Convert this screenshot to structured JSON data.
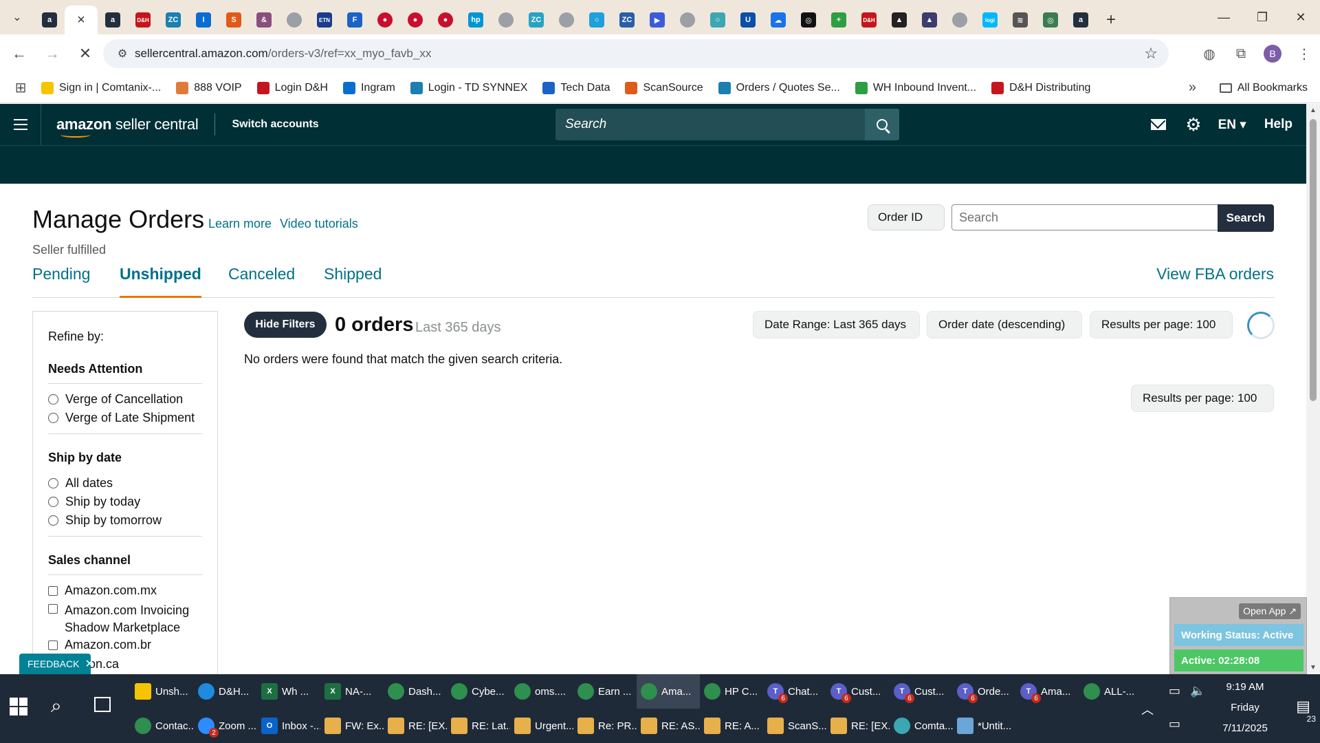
{
  "browser": {
    "tabs": [
      {
        "label": "a",
        "color": "#232f3e"
      },
      {
        "label": "×",
        "color": "",
        "active": true
      },
      {
        "label": "a",
        "color": "#232f3e"
      },
      {
        "label": "D&H",
        "color": "#c4161c"
      },
      {
        "label": "ZC",
        "color": "#1b7fb0"
      },
      {
        "label": "I",
        "color": "#0a6ed1"
      },
      {
        "label": "S",
        "color": "#e05a1a"
      },
      {
        "label": "&",
        "color": "#8a4f7d"
      },
      {
        "label": "",
        "color": "#9aa0a6"
      },
      {
        "label": "ETN",
        "color": "#1a3c8c"
      },
      {
        "label": "F",
        "color": "#1b63c6"
      },
      {
        "label": "●",
        "color": "#c8102e"
      },
      {
        "label": "●",
        "color": "#c8102e"
      },
      {
        "label": "●",
        "color": "#c8102e"
      },
      {
        "label": "hp",
        "color": "#0096d6"
      },
      {
        "label": "",
        "color": "#9aa0a6"
      },
      {
        "label": "ZC",
        "color": "#27a3c4"
      },
      {
        "label": "",
        "color": "#9aa0a6"
      },
      {
        "label": "○",
        "color": "#1ea0dc"
      },
      {
        "label": "ZC",
        "color": "#2a5fa8"
      },
      {
        "label": "▶",
        "color": "#3b5bdb"
      },
      {
        "label": "",
        "color": "#9aa0a6"
      },
      {
        "label": "○",
        "color": "#3ba7b3"
      },
      {
        "label": "U",
        "color": "#0b4fa8"
      },
      {
        "label": "☁",
        "color": "#1a73e8"
      },
      {
        "label": "◎",
        "color": "#111111"
      },
      {
        "label": "+",
        "color": "#2e9e44"
      },
      {
        "label": "D&H",
        "color": "#c4161c"
      },
      {
        "label": "▲",
        "color": "#222222"
      },
      {
        "label": "▲",
        "color": "#3c3c6e"
      },
      {
        "label": "",
        "color": "#9aa0a6"
      },
      {
        "label": "logi",
        "color": "#00b8fc"
      },
      {
        "label": "≋",
        "color": "#555555"
      },
      {
        "label": "◎",
        "color": "#3b7d4f"
      },
      {
        "label": "a",
        "color": "#232f3e"
      }
    ],
    "url_host": "sellercentral.amazon.com",
    "url_path": "/orders-v3/ref=xx_myo_favb_xx",
    "profile_initial": "B",
    "bookmarks": [
      {
        "label": "Sign in | Comtanix-...",
        "color": "#f5c400"
      },
      {
        "label": "888 VOIP",
        "color": "#e07a3a"
      },
      {
        "label": "Login D&H",
        "color": "#c4161c"
      },
      {
        "label": "Ingram",
        "color": "#0a6ed1"
      },
      {
        "label": "Login - TD SYNNEX",
        "color": "#1b7fb0"
      },
      {
        "label": "Tech Data",
        "color": "#1b63c6"
      },
      {
        "label": "ScanSource",
        "color": "#e05a1a"
      },
      {
        "label": "Orders / Quotes Se...",
        "color": "#1b7fb0"
      },
      {
        "label": "WH Inbound Invent...",
        "color": "#2e9e44"
      },
      {
        "label": "D&H Distributing",
        "color": "#c4161c"
      }
    ],
    "all_bookmarks": "All Bookmarks"
  },
  "header": {
    "logo_brand": "amazon",
    "logo_product": "seller central",
    "switch_accounts": "Switch accounts",
    "search_placeholder": "Search",
    "language": "EN",
    "help": "Help"
  },
  "page": {
    "title": "Manage Orders",
    "learn_more": "Learn more",
    "video_tutorials": "Video tutorials",
    "subtitle": "Seller fulfilled",
    "search_type": "Order ID",
    "search_placeholder": "Search",
    "search_button": "Search",
    "tabs": [
      "Pending",
      "Unshipped",
      "Canceled",
      "Shipped"
    ],
    "active_tab": "Unshipped",
    "fba_link": "View FBA orders"
  },
  "filters": {
    "refine_by": "Refine by:",
    "needs_attention": {
      "title": "Needs Attention",
      "options": [
        "Verge of Cancellation",
        "Verge of Late Shipment"
      ]
    },
    "ship_by_date": {
      "title": "Ship by date",
      "options": [
        "All dates",
        "Ship by today",
        "Ship by tomorrow"
      ]
    },
    "sales_channel": {
      "title": "Sales channel",
      "options": [
        "Amazon.com.mx",
        "Amazon.com Invoicing Shadow Marketplace",
        "Amazon.com.br"
      ]
    },
    "partial_option": "zon.ca"
  },
  "results": {
    "hide_filters": "Hide Filters",
    "count": "0 orders",
    "range_label": "Last 365 days",
    "date_range": "Date Range: Last 365 days",
    "sort": "Order date (descending)",
    "per_page": "Results per page: 100",
    "per_page_bottom": "Results per page: 100",
    "empty_message": "No orders were found that match the given search criteria."
  },
  "feedback": {
    "label": "FEEDBACK"
  },
  "widget": {
    "open_app": "Open App ↗",
    "working_status": "Working Status: Active",
    "active_timer": "Active: 02:28:08"
  },
  "taskbar": {
    "row1": [
      {
        "label": "Unsh...",
        "color": "#f5c400",
        "icon": "folder"
      },
      {
        "label": "D&H...",
        "color": "#1f8ae0",
        "icon": "edge"
      },
      {
        "label": "Wh ...",
        "color": "#1d6f42",
        "icon": "X"
      },
      {
        "label": "NA-...",
        "color": "#1d6f42",
        "icon": "X"
      },
      {
        "label": "Dash...",
        "color": "#2f8f4e",
        "icon": "chrome"
      },
      {
        "label": "Cybe...",
        "color": "#2f8f4e",
        "icon": "chrome"
      },
      {
        "label": "oms....",
        "color": "#2f8f4e",
        "icon": "chrome"
      },
      {
        "label": "Earn ...",
        "color": "#2f8f4e",
        "icon": "chrome"
      },
      {
        "label": "Ama...",
        "color": "#2f8f4e",
        "icon": "chrome",
        "active": true
      },
      {
        "label": "HP C...",
        "color": "#2f8f4e",
        "icon": "chrome"
      },
      {
        "label": "Chat...",
        "color": "#5b5fc7",
        "icon": "T",
        "badge": "6"
      },
      {
        "label": "Cust...",
        "color": "#5b5fc7",
        "icon": "T",
        "badge": "6"
      },
      {
        "label": "Cust...",
        "color": "#5b5fc7",
        "icon": "T",
        "badge": "6"
      },
      {
        "label": "Orde...",
        "color": "#5b5fc7",
        "icon": "T",
        "badge": "6"
      },
      {
        "label": "Ama...",
        "color": "#5b5fc7",
        "icon": "T",
        "badge": "6"
      },
      {
        "label": "ALL-...",
        "color": "#2f8f4e",
        "icon": "chrome"
      }
    ],
    "row2": [
      {
        "label": "Contac...",
        "color": "#2f8f4e",
        "icon": "chrome"
      },
      {
        "label": "Zoom ...",
        "color": "#2d8cff",
        "icon": "zm",
        "badge": "2"
      },
      {
        "label": "Inbox -...",
        "color": "#0a64c8",
        "icon": "O"
      },
      {
        "label": "FW: Ex...",
        "color": "#e8b04a",
        "icon": "mail"
      },
      {
        "label": "RE: [EX...",
        "color": "#e8b04a",
        "icon": "mail"
      },
      {
        "label": "RE: Lat...",
        "color": "#e8b04a",
        "icon": "mail"
      },
      {
        "label": "Urgent...",
        "color": "#e8b04a",
        "icon": "mail"
      },
      {
        "label": "Re: PR...",
        "color": "#e8b04a",
        "icon": "mail"
      },
      {
        "label": "RE: AS...",
        "color": "#e8b04a",
        "icon": "mail"
      },
      {
        "label": "RE: A...",
        "color": "#e8b04a",
        "icon": "mail"
      },
      {
        "label": "ScanS...",
        "color": "#e8b04a",
        "icon": "mail"
      },
      {
        "label": "RE: [EX...",
        "color": "#e8b04a",
        "icon": "mail"
      },
      {
        "label": "Comta...",
        "color": "#3ba7b3",
        "icon": "app"
      },
      {
        "label": "*Untit...",
        "color": "#6aa6d8",
        "icon": "note"
      }
    ],
    "time": "9:19 AM",
    "day": "Friday",
    "date": "7/11/2025",
    "notifications": "23"
  }
}
